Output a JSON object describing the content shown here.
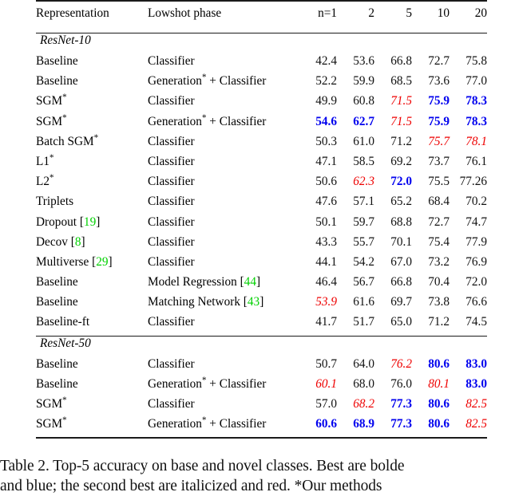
{
  "table": {
    "columns": {
      "representation": "Representation",
      "lowshot_phase": "Lowshot phase",
      "shots": [
        "n=1",
        "2",
        "5",
        "10",
        "20"
      ]
    },
    "sections": [
      {
        "name": "ResNet-10",
        "rows": [
          {
            "representation": "Baseline",
            "rep_star": false,
            "phase": "Classifier",
            "phase_star": false,
            "phase_cite": "",
            "values": [
              "42.4",
              "53.6",
              "66.8",
              "72.7",
              "75.8"
            ],
            "styles": [
              "plain",
              "plain",
              "plain",
              "plain",
              "plain"
            ]
          },
          {
            "representation": "Baseline",
            "rep_star": false,
            "phase": "Generation",
            "phase_star": true,
            "phase_suffix": "+ Classifier",
            "phase_cite": "",
            "values": [
              "52.2",
              "59.9",
              "68.5",
              "73.6",
              "77.0"
            ],
            "styles": [
              "plain",
              "plain",
              "plain",
              "plain",
              "plain"
            ]
          },
          {
            "representation": "SGM",
            "rep_star": true,
            "phase": "Classifier",
            "phase_star": false,
            "phase_cite": "",
            "values": [
              "49.9",
              "60.8",
              "71.5",
              "75.9",
              "78.3"
            ],
            "styles": [
              "plain",
              "plain",
              "second",
              "best",
              "best"
            ]
          },
          {
            "representation": "SGM",
            "rep_star": true,
            "phase": "Generation",
            "phase_star": true,
            "phase_suffix": "+ Classifier",
            "phase_cite": "",
            "values": [
              "54.6",
              "62.7",
              "71.5",
              "75.9",
              "78.3"
            ],
            "styles": [
              "best",
              "best",
              "second",
              "best",
              "best"
            ]
          },
          {
            "representation": "Batch SGM",
            "rep_star": true,
            "phase": "Classifier",
            "phase_star": false,
            "phase_cite": "",
            "values": [
              "50.3",
              "61.0",
              "71.2",
              "75.7",
              "78.1"
            ],
            "styles": [
              "plain",
              "plain",
              "plain",
              "second",
              "second"
            ]
          },
          {
            "representation": "L1",
            "rep_star": true,
            "phase": "Classifier",
            "phase_star": false,
            "phase_cite": "",
            "values": [
              "47.1",
              "58.5",
              "69.2",
              "73.7",
              "76.1"
            ],
            "styles": [
              "plain",
              "plain",
              "plain",
              "plain",
              "plain"
            ]
          },
          {
            "representation": "L2",
            "rep_star": true,
            "phase": "Classifier",
            "phase_star": false,
            "phase_cite": "",
            "values": [
              "50.6",
              "62.3",
              "72.0",
              "75.5",
              "77.26"
            ],
            "styles": [
              "plain",
              "second",
              "best",
              "plain",
              "plain"
            ]
          },
          {
            "representation": "Triplets",
            "rep_star": false,
            "phase": "Classifier",
            "phase_star": false,
            "phase_cite": "",
            "values": [
              "47.6",
              "57.1",
              "65.2",
              "68.4",
              "70.2"
            ],
            "styles": [
              "plain",
              "plain",
              "plain",
              "plain",
              "plain"
            ]
          },
          {
            "representation": "Dropout",
            "rep_star": false,
            "rep_cite": "19",
            "phase": "Classifier",
            "phase_star": false,
            "phase_cite": "",
            "values": [
              "50.1",
              "59.7",
              "68.8",
              "72.7",
              "74.7"
            ],
            "styles": [
              "plain",
              "plain",
              "plain",
              "plain",
              "plain"
            ]
          },
          {
            "representation": "Decov",
            "rep_star": false,
            "rep_cite": "8",
            "phase": "Classifier",
            "phase_star": false,
            "phase_cite": "",
            "values": [
              "43.3",
              "55.7",
              "70.1",
              "75.4",
              "77.9"
            ],
            "styles": [
              "plain",
              "plain",
              "plain",
              "plain",
              "plain"
            ]
          },
          {
            "representation": "Multiverse",
            "rep_star": false,
            "rep_cite": "29",
            "phase": "Classifier",
            "phase_star": false,
            "phase_cite": "",
            "values": [
              "44.1",
              "54.2",
              "67.0",
              "73.2",
              "76.9"
            ],
            "styles": [
              "plain",
              "plain",
              "plain",
              "plain",
              "plain"
            ]
          },
          {
            "representation": "Baseline",
            "rep_star": false,
            "phase": "Model Regression",
            "phase_star": false,
            "phase_cite": "44",
            "values": [
              "46.4",
              "56.7",
              "66.8",
              "70.4",
              "72.0"
            ],
            "styles": [
              "plain",
              "plain",
              "plain",
              "plain",
              "plain"
            ]
          },
          {
            "representation": "Baseline",
            "rep_star": false,
            "phase": "Matching Network",
            "phase_star": false,
            "phase_cite": "43",
            "values": [
              "53.9",
              "61.6",
              "69.7",
              "73.8",
              "76.6"
            ],
            "styles": [
              "second",
              "plain",
              "plain",
              "plain",
              "plain"
            ]
          },
          {
            "representation": "Baseline-ft",
            "rep_star": false,
            "phase": "Classifier",
            "phase_star": false,
            "phase_cite": "",
            "values": [
              "41.7",
              "51.7",
              "65.0",
              "71.2",
              "74.5"
            ],
            "styles": [
              "plain",
              "plain",
              "plain",
              "plain",
              "plain"
            ]
          }
        ]
      },
      {
        "name": "ResNet-50",
        "rows": [
          {
            "representation": "Baseline",
            "rep_star": false,
            "phase": "Classifier",
            "phase_star": false,
            "phase_cite": "",
            "values": [
              "50.7",
              "64.0",
              "76.2",
              "80.6",
              "83.0"
            ],
            "styles": [
              "plain",
              "plain",
              "second",
              "best",
              "best"
            ]
          },
          {
            "representation": "Baseline",
            "rep_star": false,
            "phase": "Generation",
            "phase_star": true,
            "phase_suffix": "+ Classifier",
            "phase_cite": "",
            "values": [
              "60.1",
              "68.0",
              "76.0",
              "80.1",
              "83.0"
            ],
            "styles": [
              "second",
              "plain",
              "plain",
              "second",
              "best"
            ]
          },
          {
            "representation": "SGM",
            "rep_star": true,
            "phase": "Classifier",
            "phase_star": false,
            "phase_cite": "",
            "values": [
              "57.0",
              "68.2",
              "77.3",
              "80.6",
              "82.5"
            ],
            "styles": [
              "plain",
              "second",
              "best",
              "best",
              "second"
            ]
          },
          {
            "representation": "SGM",
            "rep_star": true,
            "phase": "Generation",
            "phase_star": true,
            "phase_suffix": "+ Classifier",
            "phase_cite": "",
            "values": [
              "60.6",
              "68.9",
              "77.3",
              "80.6",
              "82.5"
            ],
            "styles": [
              "best",
              "best",
              "best",
              "best",
              "second"
            ]
          }
        ]
      }
    ]
  },
  "caption": {
    "line1": "Table 2. Top-5 accuracy on base and novel classes. Best are bolde",
    "line2": "and blue; the second best are italicized and red. *Our methods"
  },
  "colors": {
    "best": "#0000ee",
    "second": "#ee0000",
    "citation": "#00d000",
    "text": "#111111",
    "rule": "#1a1a1a"
  }
}
